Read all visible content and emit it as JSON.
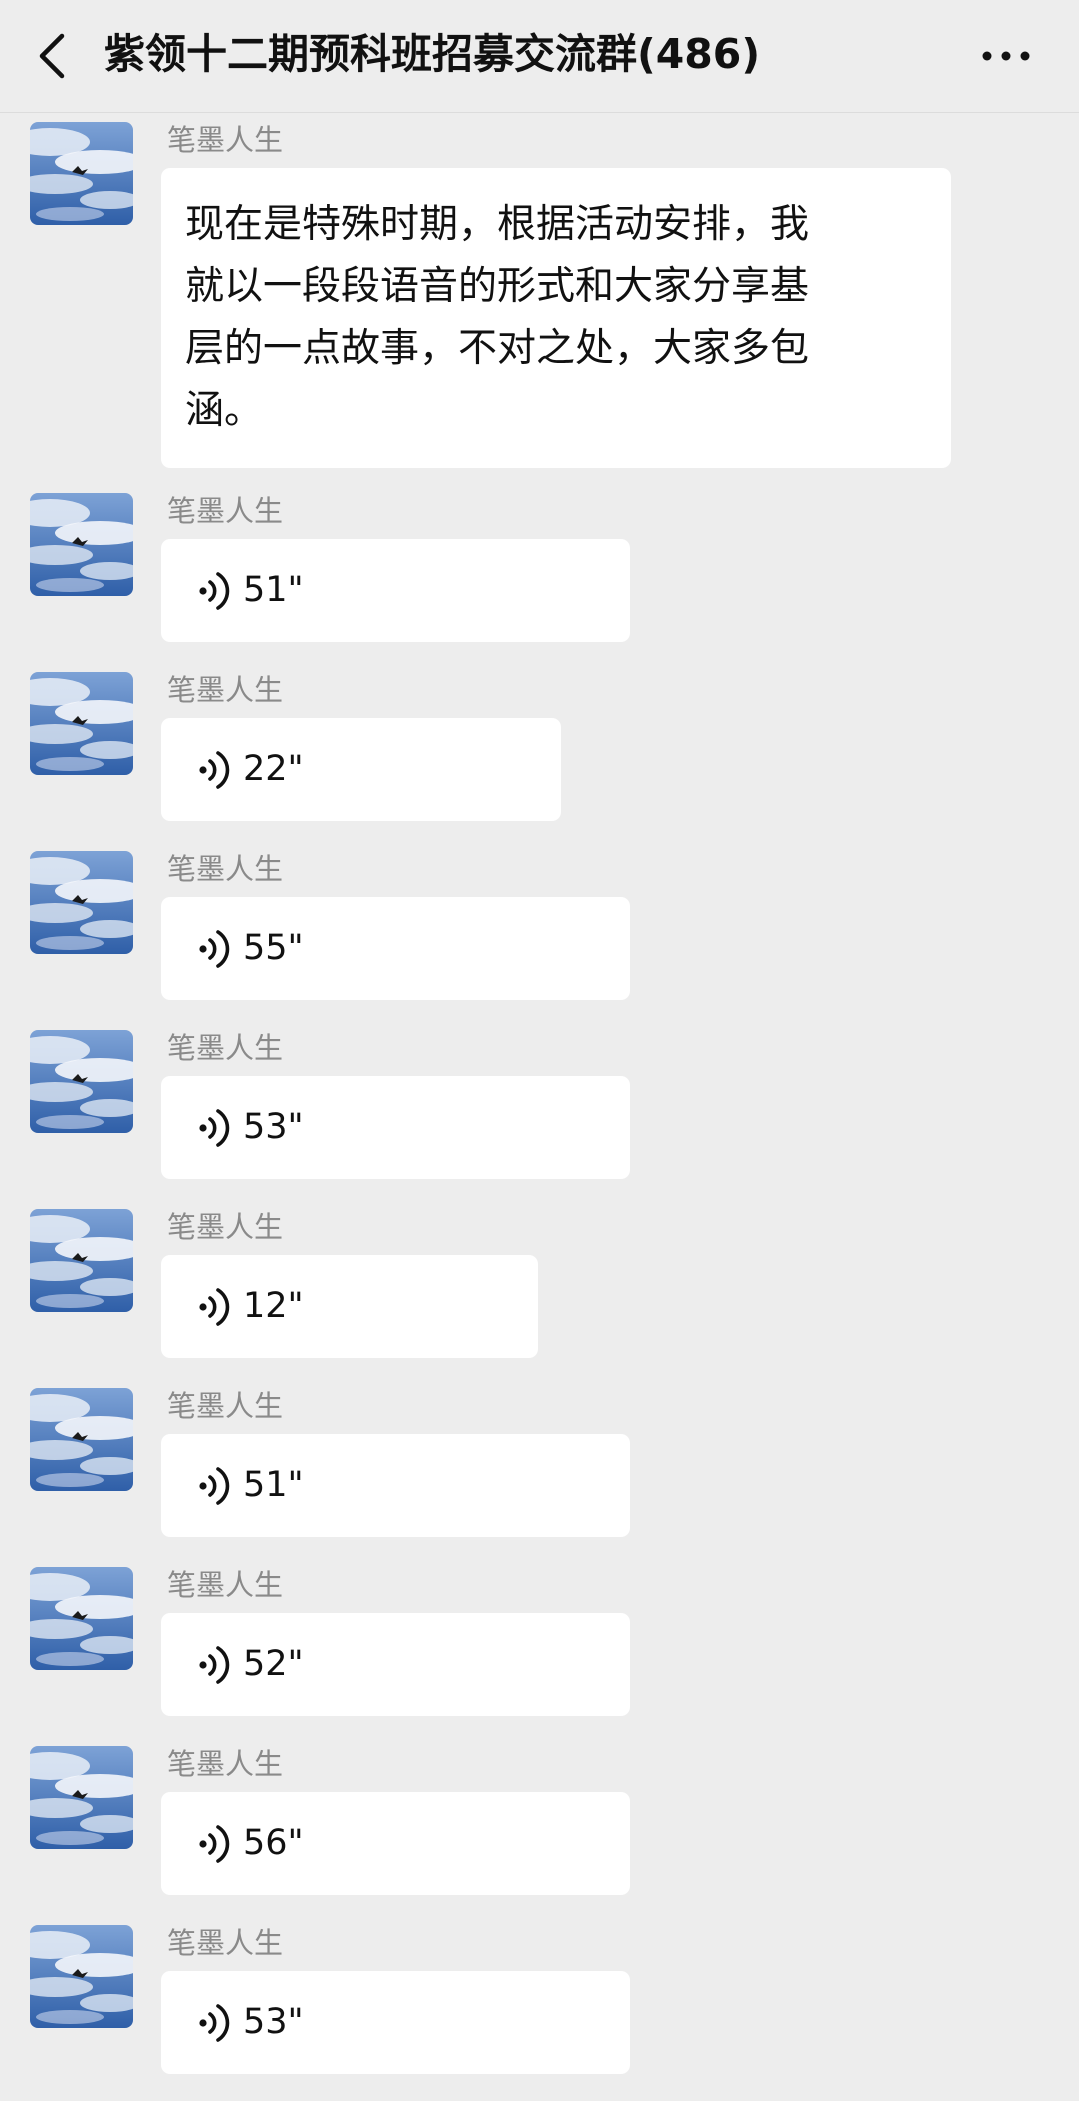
{
  "header": {
    "title": "紫领十二期预科班招募交流群(486)",
    "back_icon": "chevron-left-icon",
    "more_icon": "more-dots-icon"
  },
  "colors": {
    "background": "#ededed",
    "bubble": "#ffffff",
    "sender_name": "#8a8a8a",
    "text": "#111111"
  },
  "messages": [
    {
      "sender": "笔墨人生",
      "type": "text",
      "text": "现在是特殊时期，根据活动安排，我\n就以一段段语音的形式和大家分享基\n层的一点故事，不对之处，大家多包\n涵。"
    },
    {
      "sender": "笔墨人生",
      "type": "voice",
      "duration": "51\""
    },
    {
      "sender": "笔墨人生",
      "type": "voice",
      "duration": "22\""
    },
    {
      "sender": "笔墨人生",
      "type": "voice",
      "duration": "55\""
    },
    {
      "sender": "笔墨人生",
      "type": "voice",
      "duration": "53\""
    },
    {
      "sender": "笔墨人生",
      "type": "voice",
      "duration": "12\""
    },
    {
      "sender": "笔墨人生",
      "type": "voice",
      "duration": "51\""
    },
    {
      "sender": "笔墨人生",
      "type": "voice",
      "duration": "52\""
    },
    {
      "sender": "笔墨人生",
      "type": "voice",
      "duration": "56\""
    },
    {
      "sender": "笔墨人生",
      "type": "voice",
      "duration": "53\""
    }
  ]
}
